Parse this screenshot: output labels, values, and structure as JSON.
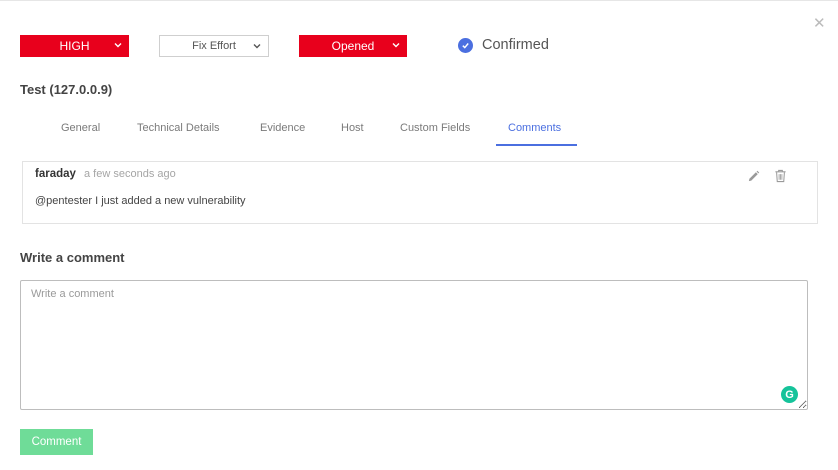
{
  "header": {
    "severity": {
      "label": "HIGH",
      "color": "#e8001c"
    },
    "fix_effort": {
      "label": "Fix Effort"
    },
    "status": {
      "label": "Opened",
      "color": "#e8001c"
    },
    "confirmed": {
      "label": "Confirmed",
      "icon": "check-circle-icon",
      "color": "#4b6fe0"
    },
    "close_icon": "close-icon"
  },
  "title": "Test (127.0.0.9)",
  "tabs": [
    {
      "label": "General",
      "active": false
    },
    {
      "label": "Technical Details",
      "active": false
    },
    {
      "label": "Evidence",
      "active": false
    },
    {
      "label": "Host",
      "active": false
    },
    {
      "label": "Custom Fields",
      "active": false
    },
    {
      "label": "Comments",
      "active": true
    }
  ],
  "comments": [
    {
      "author": "faraday",
      "time": "a few seconds ago",
      "text": "@pentester I just added a new vulnerability",
      "actions": [
        "pencil-icon",
        "trash-icon"
      ]
    }
  ],
  "write_comment": {
    "heading": "Write a comment",
    "placeholder": "Write a comment",
    "value": "",
    "submit_label": "Comment",
    "submit_color": "#6fdc98"
  },
  "grammarly_icon": {
    "glyph": "G",
    "color": "#15c39a"
  }
}
